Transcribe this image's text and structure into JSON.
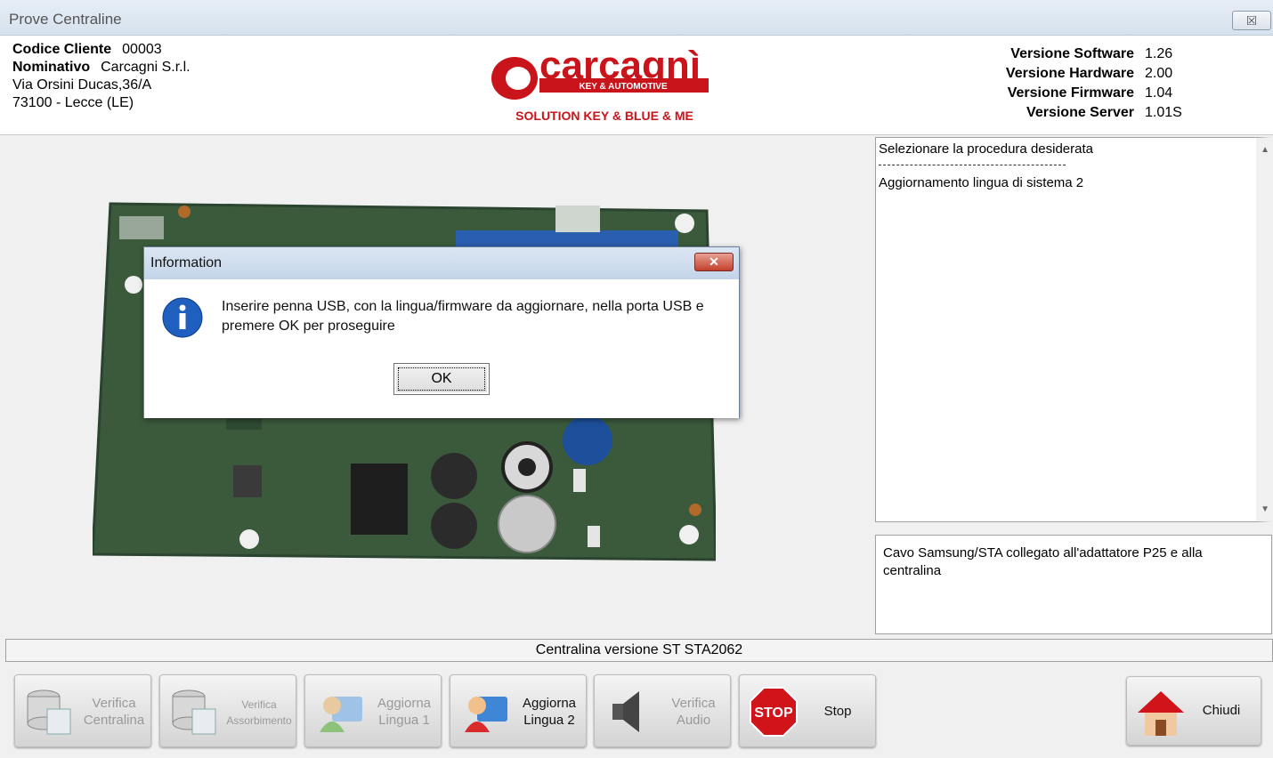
{
  "window": {
    "title": "Prove Centraline",
    "close_glyph": "⮽"
  },
  "client": {
    "codice_label": "Codice Cliente",
    "codice_value": "00003",
    "nominativo_label": "Nominativo",
    "nominativo_value": "Carcagni S.r.l.",
    "address": "Via Orsini Ducas,36/A",
    "city": "73100 - Lecce (LE)"
  },
  "logo": {
    "brand": "carcagnì",
    "tagline": "KEY & AUTOMOTIVE",
    "subtitle": "SOLUTION KEY & BLUE & ME"
  },
  "versions": [
    {
      "label": "Versione Software",
      "value": "1.26"
    },
    {
      "label": "Versione Hardware",
      "value": "2.00"
    },
    {
      "label": "Versione Firmware",
      "value": "1.04"
    },
    {
      "label": "Versione Server",
      "value": "1.01S"
    }
  ],
  "log": {
    "line1": "Selezionare la procedura desiderata",
    "line2": "Aggiornamento lingua di sistema 2"
  },
  "info": "Cavo Samsung/STA collegato all'adattatore P25 e alla centralina",
  "status": "Centralina versione ST STA2062",
  "buttons": {
    "verifica_centralina": "Verifica Centralina",
    "verifica_assorbimento": "Verifica Assorbimento",
    "aggiorna_lingua_1": "Aggiorna Lingua 1",
    "aggiorna_lingua_2": "Aggiorna Lingua 2",
    "verifica_audio": "Verifica Audio",
    "stop": "Stop",
    "stop_sign": "STOP",
    "chiudi": "Chiudi"
  },
  "dialog": {
    "title": "Information",
    "message": "Inserire penna USB, con la lingua/firmware da aggiornare, nella porta USB e premere OK per proseguire",
    "ok": "OK",
    "close_glyph": "✕",
    "icon": "info-icon"
  },
  "colors": {
    "brand_red": "#c8141a",
    "pcb_green": "#3b5a3c",
    "dialog_title": "#c3d4e8"
  }
}
